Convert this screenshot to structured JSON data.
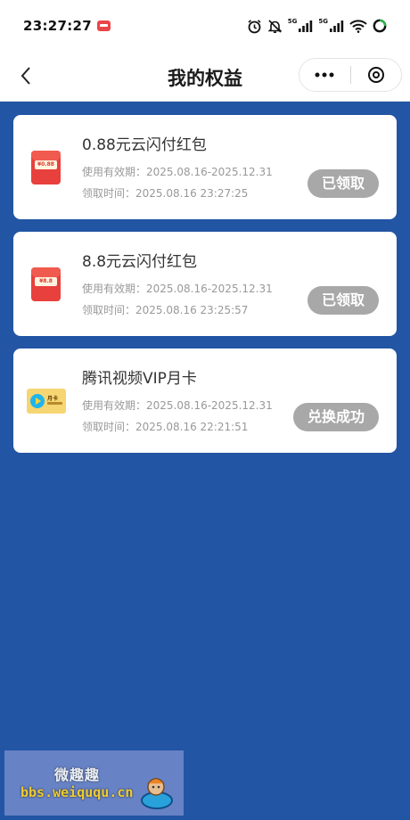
{
  "status_bar": {
    "time": "23:27:27",
    "signal_label_1": "5G",
    "signal_label_2": "5G",
    "icons": [
      "notification-badge-icon",
      "alarm-icon",
      "mute-icon",
      "signal-icon",
      "signal-icon",
      "wifi-icon",
      "battery-icon"
    ]
  },
  "nav": {
    "title": "我的权益",
    "back_icon": "chevron-left-icon",
    "more_icon": "more-dots-icon",
    "close_icon": "circle-close-icon"
  },
  "cards": [
    {
      "title": "0.88元云闪付红包",
      "validity": "使用有效期：2025.08.16-2025.12.31",
      "claim_time": "领取时间：2025.08.16 23:27:25",
      "status": "已领取",
      "icon": "red-envelope-icon",
      "icon_amount": "¥0.88"
    },
    {
      "title": "8.8元云闪付红包",
      "validity": "使用有效期：2025.08.16-2025.12.31",
      "claim_time": "领取时间：2025.08.16 23:25:57",
      "status": "已领取",
      "icon": "red-envelope-icon",
      "icon_amount": "¥8.8"
    },
    {
      "title": "腾讯视频VIP月卡",
      "validity": "使用有效期：2025.08.16-2025.12.31",
      "claim_time": "领取时间：2025.08.16 22:21:51",
      "status": "兑换成功",
      "icon": "tencent-video-vip-card-icon",
      "icon_label": "月卡"
    }
  ],
  "watermark": {
    "title": "微趣趣",
    "url": "bbs.weiququ.cn"
  },
  "colors": {
    "page_background": "#2255A4",
    "card_background": "#FFFFFF",
    "status_button": "#A8A8A8",
    "watermark_url": "#FFD52A"
  }
}
